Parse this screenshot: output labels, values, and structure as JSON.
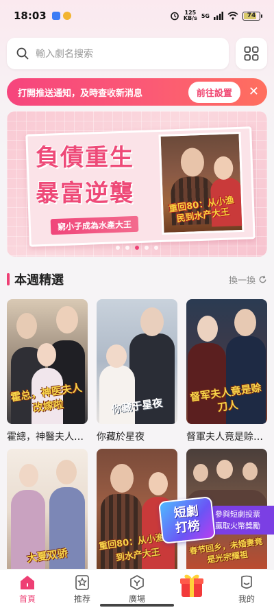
{
  "status_bar": {
    "time": "18:03",
    "net_speed_value": "125",
    "net_speed_unit": "KB/s",
    "signal_label": "5G",
    "battery": "74"
  },
  "search": {
    "placeholder": "輸入劇名搜索",
    "search_icon": "search-icon",
    "grid_icon": "grid-icon"
  },
  "notification": {
    "text": "打開推送通知，及時查收新消息",
    "button_label": "前往設置",
    "close_symbol": "✕"
  },
  "banner": {
    "title_line1": "負債重生",
    "title_line2": "暴富逆襲",
    "subtitle": "窮小子成為水產大王",
    "poster_title": "重回80：从小渔民到水产大王",
    "dots_count": 5,
    "active_dot": 2
  },
  "section": {
    "title": "本週精選",
    "refresh_label": "換一換"
  },
  "dramas": [
    {
      "title": "霍總，神醫夫人改嫁啦",
      "art_title": "霍总，神医夫人改嫁啦",
      "style": "p1"
    },
    {
      "title": "你藏於星夜",
      "art_title": "你藏于星夜",
      "style": "p2"
    },
    {
      "title": "督軍夫人竟是賒刀人",
      "art_title": "督军夫人竟是赊刀人",
      "style": "p3"
    },
    {
      "title": "",
      "art_title": "大夏双骄",
      "style": "p4"
    },
    {
      "title": "",
      "art_title": "重回80：从小渔民到水产大王",
      "style": "p5"
    },
    {
      "title": "",
      "art_title": "春节回乡，未婚妻竟是光宗耀祖",
      "style": "p6"
    }
  ],
  "rank_float": {
    "badge_line1": "短劇",
    "badge_line2": "打榜",
    "note_line1": "參與短劇投票",
    "note_line2": "贏取火幣獎勵"
  },
  "tabs": [
    {
      "label": "首頁",
      "icon": "home-icon",
      "active": true
    },
    {
      "label": "推荐",
      "icon": "star-bookmark-icon",
      "active": false
    },
    {
      "label": "廣場",
      "icon": "plaza-icon",
      "active": false
    },
    {
      "label": "",
      "icon": "gift-icon",
      "active": false
    },
    {
      "label": "我的",
      "icon": "profile-icon",
      "active": false
    }
  ],
  "colors": {
    "accent": "#ee3f74",
    "notification_start": "#f6457d",
    "notification_end": "#ff6f5e",
    "rank_purple": "#7b3fe4"
  }
}
